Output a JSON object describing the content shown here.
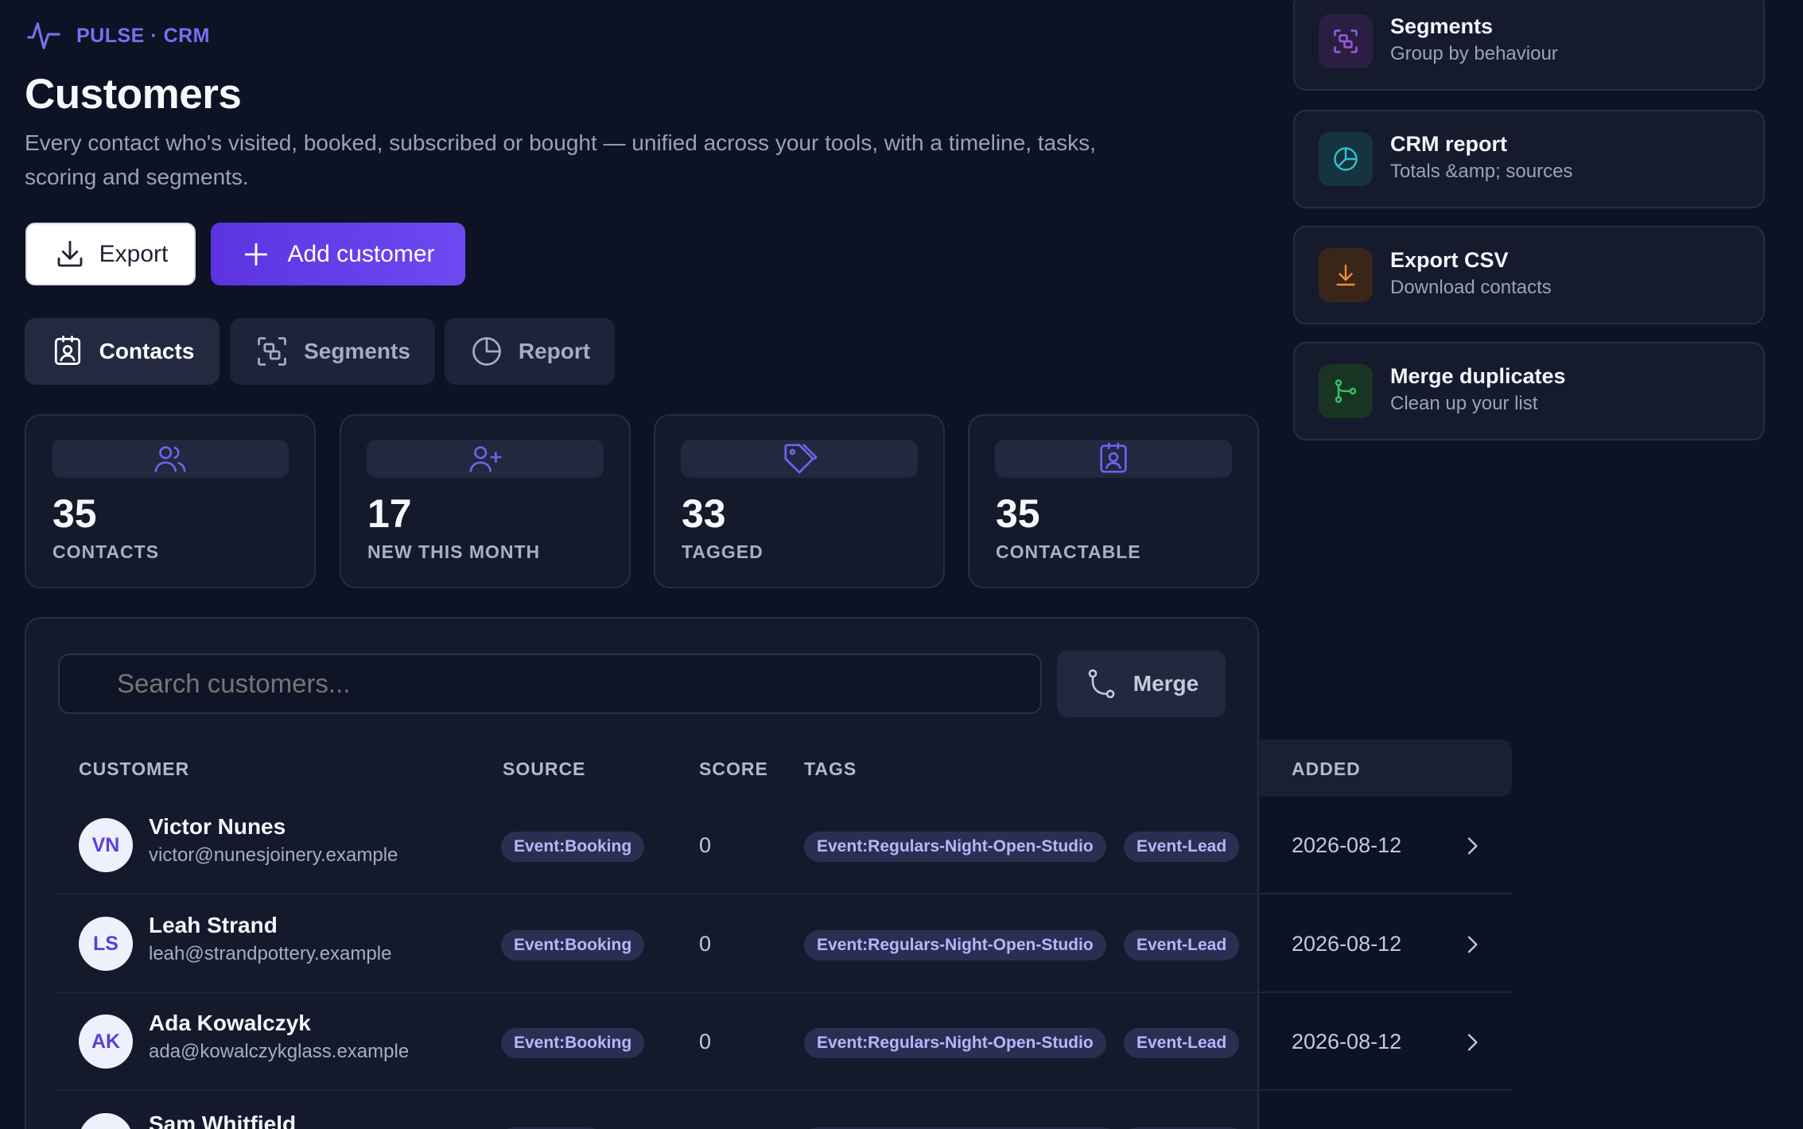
{
  "brand": {
    "name": "PULSE · CRM",
    "icon": "pulse-icon",
    "accent": "#7a6ff2"
  },
  "header": {
    "title": "Customers",
    "description": "Every contact who's visited, booked, subscribed or bought — unified across your tools, with a timeline, tasks, scoring and segments."
  },
  "actions": {
    "export_label": "Export",
    "add_label": "Add customer"
  },
  "tabs": [
    {
      "label": "Contacts",
      "icon": "contact-card-icon",
      "active": true
    },
    {
      "label": "Segments",
      "icon": "segments-icon",
      "active": false
    },
    {
      "label": "Report",
      "icon": "pie-chart-icon",
      "active": false
    }
  ],
  "stats": [
    {
      "value": "35",
      "label": "CONTACTS",
      "icon": "users-icon"
    },
    {
      "value": "17",
      "label": "NEW THIS MONTH",
      "icon": "user-plus-icon"
    },
    {
      "value": "33",
      "label": "TAGGED",
      "icon": "tag-icon"
    },
    {
      "value": "35",
      "label": "CONTACTABLE",
      "icon": "contact-card-icon"
    }
  ],
  "shortcuts": [
    {
      "title": "Segments",
      "subtitle": "Group by behaviour",
      "icon": "segments-icon",
      "color": "#8b4fd6"
    },
    {
      "title": "CRM report",
      "subtitle": "Totals &amp; sources",
      "icon": "pie-chart-icon",
      "color": "#27b5c9"
    },
    {
      "title": "Export CSV",
      "subtitle": "Download contacts",
      "icon": "download-icon",
      "color": "#e8862f"
    },
    {
      "title": "Merge duplicates",
      "subtitle": "Clean up your list",
      "icon": "merge-icon",
      "color": "#2fbf62"
    }
  ],
  "search": {
    "placeholder": "Search customers..."
  },
  "merge_label": "Merge",
  "table": {
    "columns": [
      "CUSTOMER",
      "SOURCE",
      "SCORE",
      "TAGS",
      "ADDED"
    ],
    "rows": [
      {
        "initials": "VN",
        "name": "Victor Nunes",
        "email": "victor@nunesjoinery.example",
        "source": "Event:Booking",
        "score": "0",
        "tags": [
          "Event:Regulars-Night-Open-Studio",
          "Event-Lead"
        ],
        "added": "2026-08-12"
      },
      {
        "initials": "LS",
        "name": "Leah Strand",
        "email": "leah@strandpottery.example",
        "source": "Event:Booking",
        "score": "0",
        "tags": [
          "Event:Regulars-Night-Open-Studio",
          "Event-Lead"
        ],
        "added": "2026-08-12"
      },
      {
        "initials": "AK",
        "name": "Ada Kowalczyk",
        "email": "ada@kowalczykglass.example",
        "source": "Event:Booking",
        "score": "0",
        "tags": [
          "Event:Regulars-Night-Open-Studio",
          "Event-Lead"
        ],
        "added": "2026-08-12"
      },
      {
        "initials": "",
        "name": "Sam Whitfield"
      }
    ]
  }
}
